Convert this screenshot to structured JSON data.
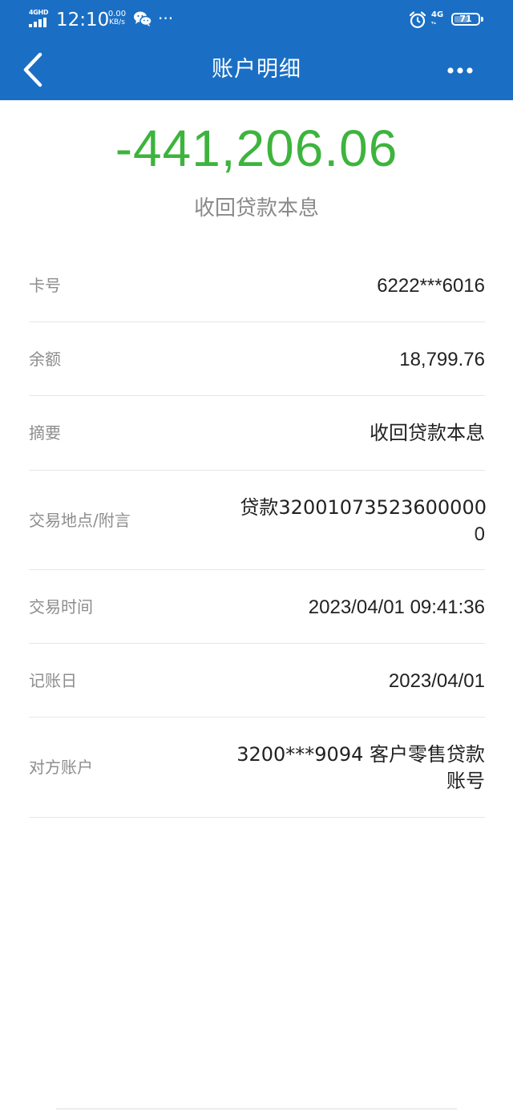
{
  "status_bar": {
    "network_label": "4GHD",
    "time": "12:10",
    "speed_value": "0.00",
    "speed_unit": "KB/s",
    "more_indicator": "···",
    "network_right": "4G",
    "battery": "71",
    "icons": [
      "signal-icon",
      "wechat-icon",
      "alarm-icon",
      "battery-icon"
    ]
  },
  "nav": {
    "title": "账户明细",
    "back_icon": "chevron-left-icon",
    "more_icon": "more-horizontal-icon"
  },
  "transaction": {
    "amount": "-441,206.06",
    "amount_color": "#3db43d",
    "description": "收回贷款本息"
  },
  "details": [
    {
      "label": "卡号",
      "value": "6222***6016"
    },
    {
      "label": "余额",
      "value": "18,799.76"
    },
    {
      "label": "摘要",
      "value": "收回贷款本息"
    },
    {
      "label": "交易地点/附言",
      "value_line1": "贷款32001073523600000",
      "value_line2": "0"
    },
    {
      "label": "交易时间",
      "value": "2023/04/01 09:41:36"
    },
    {
      "label": "记账日",
      "value": "2023/04/01"
    },
    {
      "label": "对方账户",
      "value_line1": "3200***9094 客户零售贷款",
      "value_line2": "账号"
    }
  ],
  "colors": {
    "header": "#1a6fc4",
    "label": "#8d8d8d",
    "value": "#222222",
    "divider": "#e6e6e6"
  }
}
